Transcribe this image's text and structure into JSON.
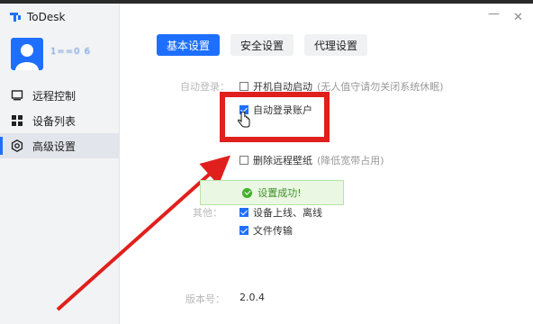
{
  "app": {
    "name": "ToDesk"
  },
  "user": {
    "account": "1==0 6"
  },
  "nav": [
    {
      "id": "remote",
      "label": "远程控制",
      "icon": "monitor-icon"
    },
    {
      "id": "devices",
      "label": "设备列表",
      "icon": "grid-icon"
    },
    {
      "id": "advanced",
      "label": "高级设置",
      "icon": "gear-icon",
      "active": true
    }
  ],
  "window_controls": {
    "minimize": "—",
    "close": "✕"
  },
  "tabs": [
    {
      "label": "基本设置",
      "active": true
    },
    {
      "label": "安全设置"
    },
    {
      "label": "代理设置"
    }
  ],
  "settings": {
    "startup_label": "自动登录：",
    "auto_start": {
      "label": "开机自动启动",
      "hint": "(无人值守请勿关闭系统休眠)",
      "checked": false
    },
    "auto_login": {
      "label": "自动登录账户",
      "checked": true
    },
    "remove_wallpaper": {
      "label": "删除远程壁纸",
      "hint": "(降低宽带占用)",
      "checked": false
    },
    "other_label": "其他：",
    "device_online": {
      "label": "设备上线、离线",
      "checked": true
    },
    "file_transfer": {
      "label": "文件传输",
      "checked": true
    },
    "version_label": "版本号：",
    "version_value": "2.0.4"
  },
  "toast": {
    "text": "设置成功!",
    "icon": "check-circle-icon"
  },
  "colors": {
    "accent": "#1e6fff",
    "highlight": "#e0201c",
    "success": "#43b02a"
  }
}
